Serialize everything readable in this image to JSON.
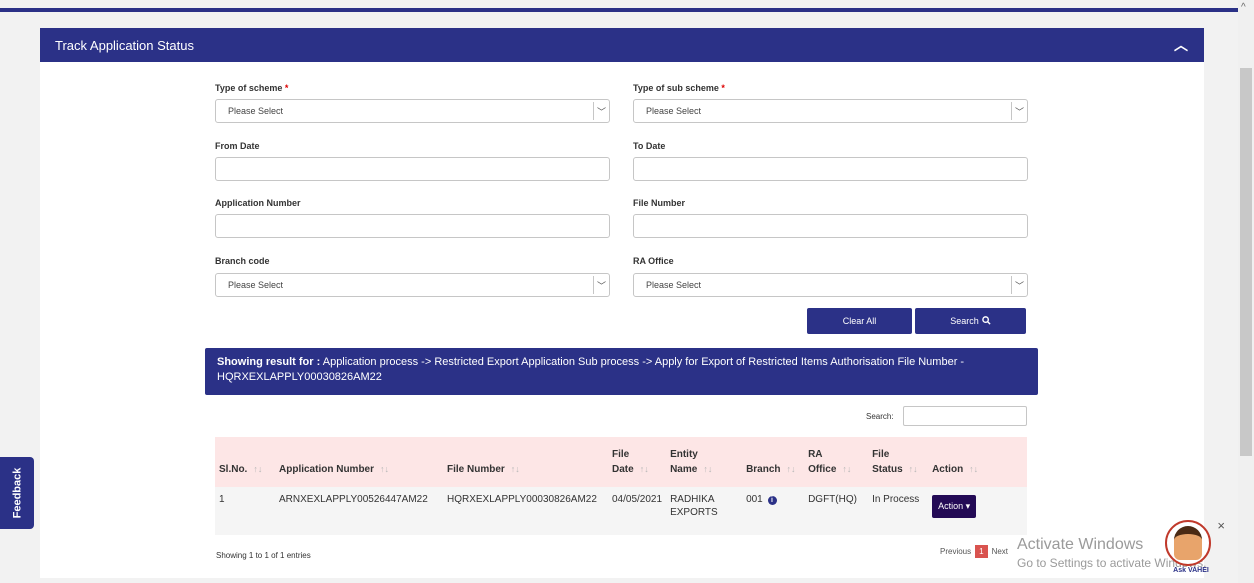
{
  "card": {
    "title": "Track Application Status",
    "collapse_icon": "chevron-up-icon"
  },
  "form": {
    "scheme_label": "Type of scheme",
    "scheme_value": "Please Select",
    "subscheme_label": "Type of sub scheme",
    "subscheme_value": "Please Select",
    "required_mark": "*",
    "from_date_label": "From Date",
    "to_date_label": "To Date",
    "app_number_label": "Application Number",
    "file_number_label": "File Number",
    "branch_label": "Branch code",
    "branch_value": "Please Select",
    "ra_office_label": "RA Office",
    "ra_office_value": "Please Select",
    "clear_label": "Clear All",
    "search_label": "Search"
  },
  "result": {
    "prefix": "Showing result for :",
    "text": "Application process -> Restricted Export Application Sub process -> Apply for Export of Restricted Items Authorisation File Number - HQRXEXLAPPLY00030826AM22"
  },
  "table_search_label": "Search:",
  "table": {
    "columns": [
      "Sl.No.",
      "Application Number",
      "File Number",
      "File Date",
      "Entity Name",
      "Branch",
      "RA Office",
      "File Status",
      "Action"
    ],
    "rows": [
      [
        "1",
        "ARNXEXLAPPLY00526447AM22",
        "HQRXEXLAPPLY00030826AM22",
        "04/05/2021",
        "RADHIKA EXPORTS",
        "001",
        "DGFT(HQ)",
        "In Process",
        "Action"
      ]
    ]
  },
  "entries_text": "Showing 1 to 1 of 1 entries",
  "pager": {
    "previous": "Previous",
    "current": "1",
    "next": "Next"
  },
  "feedback_label": "Feedback",
  "watermark": {
    "line1": "Activate Windows",
    "line2": "Go to Settings to activate Windows."
  },
  "assistant": {
    "name": "Ask VAHEI",
    "close": "×"
  }
}
